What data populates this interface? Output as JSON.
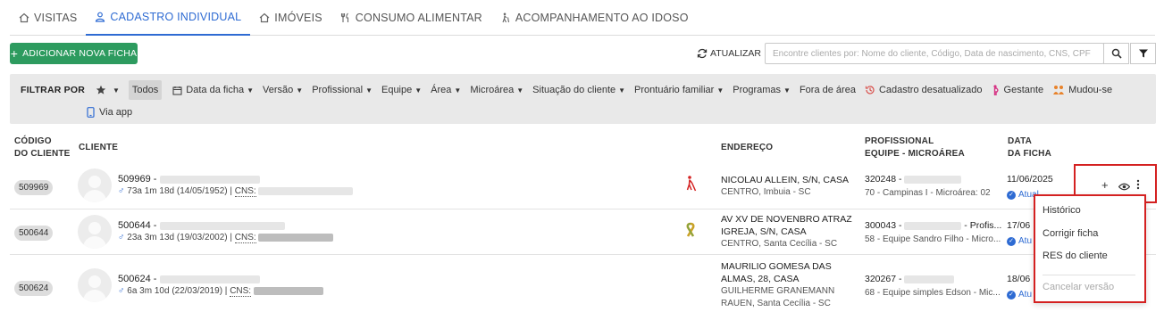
{
  "tabs": [
    {
      "label": "VISITAS",
      "icon": "house-icon",
      "active": false
    },
    {
      "label": "CADASTRO INDIVIDUAL",
      "icon": "person-icon",
      "active": true
    },
    {
      "label": "IMÓVEIS",
      "icon": "house-icon",
      "active": false
    },
    {
      "label": "CONSUMO ALIMENTAR",
      "icon": "utensils-icon",
      "active": false
    },
    {
      "label": "ACOMPANHAMENTO AO IDOSO",
      "icon": "elderly-icon",
      "active": false
    }
  ],
  "toolbar": {
    "add_label": "ADICIONAR NOVA FICHA",
    "refresh_label": "ATUALIZAR",
    "search_placeholder": "Encontre clientes por: Nome do cliente, Código, Data de nascimento, CNS, CPF"
  },
  "filters": {
    "label": "FILTRAR POR",
    "todos": "Todos",
    "items": [
      "Data da ficha",
      "Versão",
      "Profissional",
      "Equipe",
      "Área",
      "Microárea",
      "Situação do cliente",
      "Prontuário familiar",
      "Programas"
    ],
    "fora_area": "Fora de área",
    "desatualizado": "Cadastro desatualizado",
    "gestante": "Gestante",
    "mudou": "Mudou-se",
    "via_app": "Via app"
  },
  "columns": {
    "code_1": "CÓDIGO",
    "code_2": "DO CLIENTE",
    "client": "CLIENTE",
    "address": "ENDEREÇO",
    "prof_1": "PROFISSIONAL",
    "prof_2": "EQUIPE - MICROÁREA",
    "date_1": "DATA",
    "date_2": "DA FICHA"
  },
  "rows": [
    {
      "code": "509969",
      "id": "509969 -",
      "age": "73a 1m 18d (14/05/1952) | ",
      "cns_label": "CNS:",
      "addr1": "NICOLAU ALLEIN, S/N, CASA",
      "addr2": "",
      "addr3": "CENTRO, Imbuia - SC",
      "addr4": "",
      "prof_code": "320248 -",
      "prof_sub": "70 - Campinas I - Microárea: 02",
      "date": "11/06/2025",
      "status": "Atual",
      "icon": "blind-person-icon"
    },
    {
      "code": "500644",
      "id": "500644 -",
      "age": "23a 3m 13d (19/03/2002) | ",
      "cns_label": "CNS:",
      "addr1": "AV XV DE NOVENBRO ATRAZ",
      "addr2": "IGREJA, S/N, CASA",
      "addr3": "CENTRO, Santa Cecília - SC",
      "addr4": "",
      "prof_code": "300043 -",
      "prof_tail": "- Profis...",
      "prof_sub": "58 - Equipe Sandro Filho - Micro...",
      "date": "17/06",
      "status": "Atu",
      "icon": "awareness-ribbon-icon"
    },
    {
      "code": "500624",
      "id": "500624 -",
      "age": "6a 3m 10d (22/03/2019) | ",
      "cns_label": "CNS:",
      "addr1": "MAURILIO GOMESA DAS",
      "addr2": "ALMAS, 28, CASA",
      "addr3": "GUILHERME GRANEMANN",
      "addr4": "RAUEN, Santa Cecília - SC",
      "prof_code": "320267 -",
      "prof_sub": "68 - Equipe simples Edson - Mic...",
      "date": "18/06",
      "status": "Atu",
      "icon": ""
    }
  ],
  "menu": {
    "historico": "Histórico",
    "corrigir": "Corrigir ficha",
    "res": "RES do cliente",
    "cancelar": "Cancelar versão"
  },
  "colors": {
    "accent": "#2e6bd3",
    "add_button": "#2d9b5f",
    "highlight_border": "#d42121",
    "filter_bar": "#e9e9e9"
  }
}
